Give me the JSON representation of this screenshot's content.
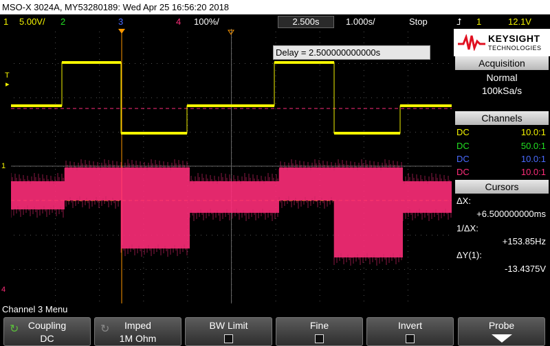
{
  "title_bar": {
    "text": "MSO-X 3024A, MY53280189: Wed Apr 25 16:56:20 2018"
  },
  "status_bar": {
    "ch1_num": "1",
    "ch1_scale": "5.00V/",
    "ch2_num": "2",
    "ch3_num": "3",
    "ch4_num": "4",
    "ch4_scale": "100%/",
    "time_delay": "2.500s",
    "time_scale": "1.000s/",
    "run_state": "Stop",
    "trig_source": "1",
    "trig_level": "12.1V"
  },
  "screen": {
    "delay_readout": "Delay = 2.500000000000s",
    "markers": {
      "trigger": "T",
      "ch1": "1",
      "ch4": "4"
    }
  },
  "logo": {
    "brand": "KEYSIGHT",
    "sub": "TECHNOLOGIES"
  },
  "acquisition": {
    "header": "Acquisition",
    "mode": "Normal",
    "rate": "100kSa/s"
  },
  "channels": {
    "header": "Channels",
    "rows": [
      {
        "coupling": "DC",
        "probe": "10.0:1",
        "color": "#f5f500"
      },
      {
        "coupling": "DC",
        "probe": "50.0:1",
        "color": "#22e022"
      },
      {
        "coupling": "DC",
        "probe": "10.0:1",
        "color": "#4a6bff"
      },
      {
        "coupling": "DC",
        "probe": "10.0:1",
        "color": "#ff2d7a"
      }
    ]
  },
  "cursors": {
    "header": "Cursors",
    "dx_label": "ΔX:",
    "dx_value": "+6.500000000ms",
    "inv_label": "1/ΔX:",
    "inv_value": "+153.85Hz",
    "dy_label": "ΔY(1):",
    "dy_value": "-13.4375V"
  },
  "menu": {
    "title": "Channel 3 Menu"
  },
  "softkeys": {
    "coupling": {
      "label": "Coupling",
      "value": "DC"
    },
    "imped": {
      "label": "Imped",
      "value": "1M Ohm"
    },
    "bwlimit": {
      "label": "BW Limit"
    },
    "fine": {
      "label": "Fine"
    },
    "invert": {
      "label": "Invert"
    },
    "probe": {
      "label": "Probe"
    }
  },
  "colors": {
    "ch1": "#f5f500",
    "ch2": "#22e022",
    "ch3": "#4a6bff",
    "ch4": "#ff2d7a",
    "trigger": "#ff9900"
  }
}
